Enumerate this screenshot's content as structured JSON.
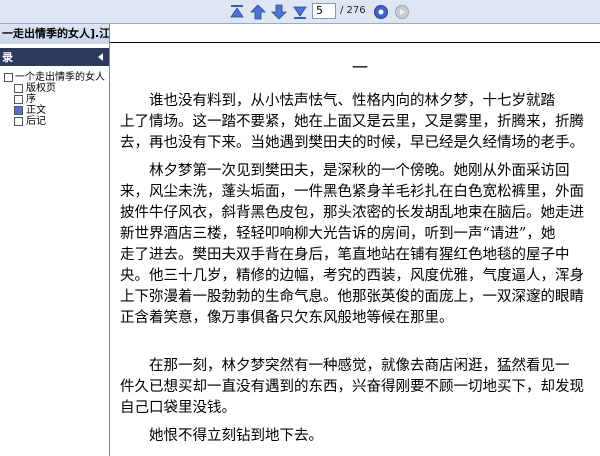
{
  "toolbar": {
    "page_current": "5",
    "page_total": "/ 276"
  },
  "panel": {
    "title": "一走出情季的女人].江…",
    "tab_label": "录",
    "tree": [
      {
        "label": "一个走出情季的女人",
        "level": 0,
        "checked": false
      },
      {
        "label": "版权页",
        "level": 1,
        "checked": false
      },
      {
        "label": "序",
        "level": 1,
        "checked": false
      },
      {
        "label": "正文",
        "level": 1,
        "checked": true
      },
      {
        "label": "后记",
        "level": 1,
        "checked": false
      }
    ]
  },
  "doc": {
    "chapter": "一",
    "paragraphs": [
      [
        "谁也没有料到，从小怯声怯气、性格内向的林夕梦，十七岁就踏",
        "上了情场。这一踏不要紧，她在上面又是云里，又是雾里，折腾来，折腾",
        "去，再也没有下来。当她遇到樊田夫的时候，早已经是久经情场的老手。"
      ],
      [
        "林夕梦第一次见到樊田夫，是深秋的一个傍晚。她刚从外面采访回",
        "来，风尘未洗，蓬头垢面，一件黑色紧身羊毛衫扎在白色宽松裤里，外面",
        "披件牛仔风衣，斜背黑色皮包，那头浓密的长发胡乱地束在脑后。她走进",
        "新世界酒店三楼，轻轻叩响柳大光告诉的房间，听到一声“请进”，她",
        "走了进去。樊田夫双手背在身后，笔直地站在铺有猩红色地毯的屋子中",
        "央。他三十几岁，精修的边幅，考究的西装，风度优雅，气度逼人，浑身",
        "上下弥漫着一股勃勃的生命气息。他那张英俊的面庞上，一双深邃的眼睛",
        "正含着笑意，像万事俱备只欠东风般地等候在那里。"
      ],
      [
        "在那一刻，林夕梦突然有一种感觉，就像去商店闲逛，猛然看见一",
        "件久已想买却一直没有遇到的东西，兴奋得刚要不顾一切地买下，却发现",
        "自己口袋里没钱。"
      ],
      [
        "她恨不得立刻钻到地下去。"
      ]
    ]
  }
}
